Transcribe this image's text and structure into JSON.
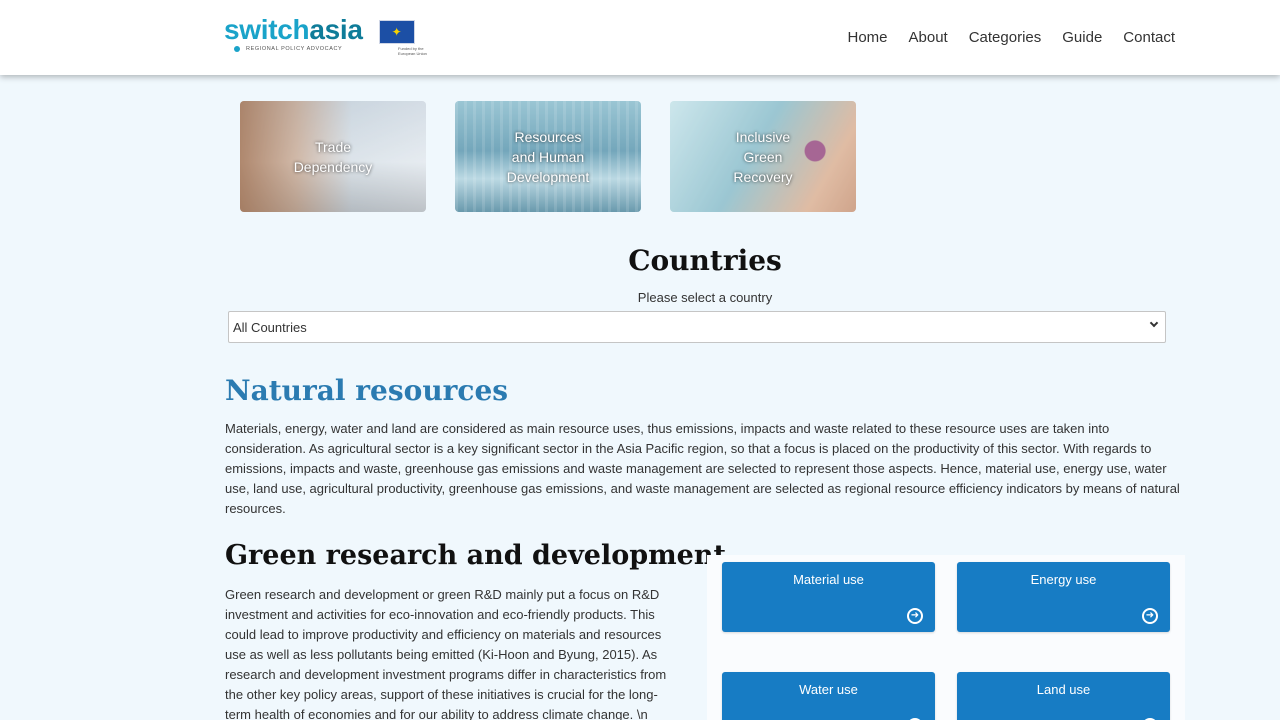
{
  "header": {
    "logo_text_a": "switch",
    "logo_text_b": "asia",
    "logo_sub": "REGIONAL POLICY ADVOCACY",
    "eu_caption": "Funded by the European Union",
    "nav": [
      "Home",
      "About",
      "Categories",
      "Guide",
      "Contact"
    ]
  },
  "categories_top_hidden": [
    "",
    "",
    "",
    ""
  ],
  "categories": [
    {
      "label": "Trade\nDependency"
    },
    {
      "label": "Resources\nand Human\nDevelopment"
    },
    {
      "label": "Inclusive\nGreen\nRecovery"
    }
  ],
  "countries": {
    "title": "Countries",
    "subtitle": "Please select a country",
    "selected": "All Countries"
  },
  "natural_resources": {
    "title": "Natural resources",
    "text": "Materials, energy, water and land are considered as main resource uses, thus emissions, impacts and waste related to these resource uses are taken into consideration. As agricultural sector is a key significant sector in the Asia Pacific region, so that a focus is placed on the productivity of this sector. With regards to emissions, impacts and waste, greenhouse gas emissions and waste management are selected to represent those aspects. Hence, material use, energy use, water use, land use, agricultural productivity, greenhouse gas emissions, and waste management are selected as regional resource efficiency indicators by means of natural resources."
  },
  "green_rd": {
    "title": "Green research and development",
    "text": "Green research and development or green R&D mainly put a focus on R&D investment and activities for eco-innovation and eco-friendly products. This could lead to improve productivity and efficiency on materials and resources use as well as less pollutants being emitted (Ki-Hoon and Byung, 2015). As research and development investment programs differ in characteristics from the other key policy areas, support of these initiatives is crucial for the long-term health of economies and for our ability to address climate change. \\n"
  },
  "indicators": [
    "Material use",
    "Energy use",
    "Water use",
    "Land use"
  ],
  "colors": {
    "accent": "#177cc4",
    "title_blue": "#2b7bb1",
    "background": "#f0f8fd"
  }
}
